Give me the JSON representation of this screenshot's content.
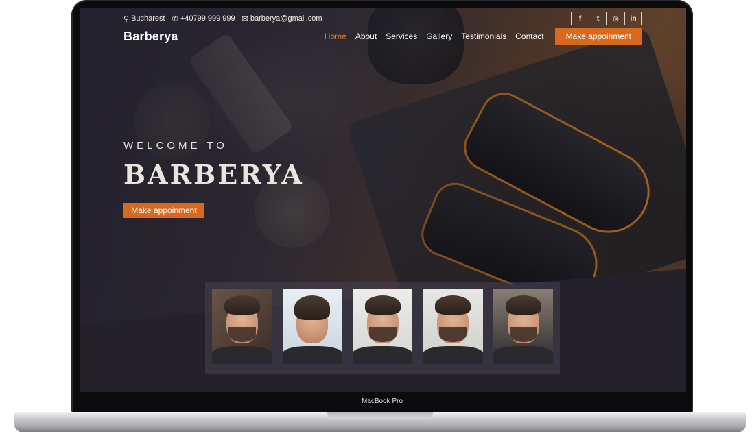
{
  "topbar": {
    "location": "Bucharest",
    "phone": "+40799 999 999",
    "email": "barberya@gmail.com",
    "socials": [
      {
        "icon": "facebook-icon",
        "glyph": "f"
      },
      {
        "icon": "twitter-icon",
        "glyph": "t"
      },
      {
        "icon": "instagram-icon",
        "glyph": "◎"
      },
      {
        "icon": "linkedin-icon",
        "glyph": "in"
      }
    ]
  },
  "navbar": {
    "brand": "Barberya",
    "links": [
      "Home",
      "About",
      "Services",
      "Gallery",
      "Testimonials",
      "Contact"
    ],
    "active": "Home",
    "cta": "Make appoinment"
  },
  "hero": {
    "subtitle": "WELCOME TO",
    "title": "BARBERYA",
    "cta": "Make appoinment"
  },
  "gallery": {
    "count": 5
  },
  "device": {
    "label": "MacBook Pro"
  },
  "colors": {
    "accent": "#d9691c",
    "active_link": "#e27825",
    "dark_band": "#24212b"
  }
}
